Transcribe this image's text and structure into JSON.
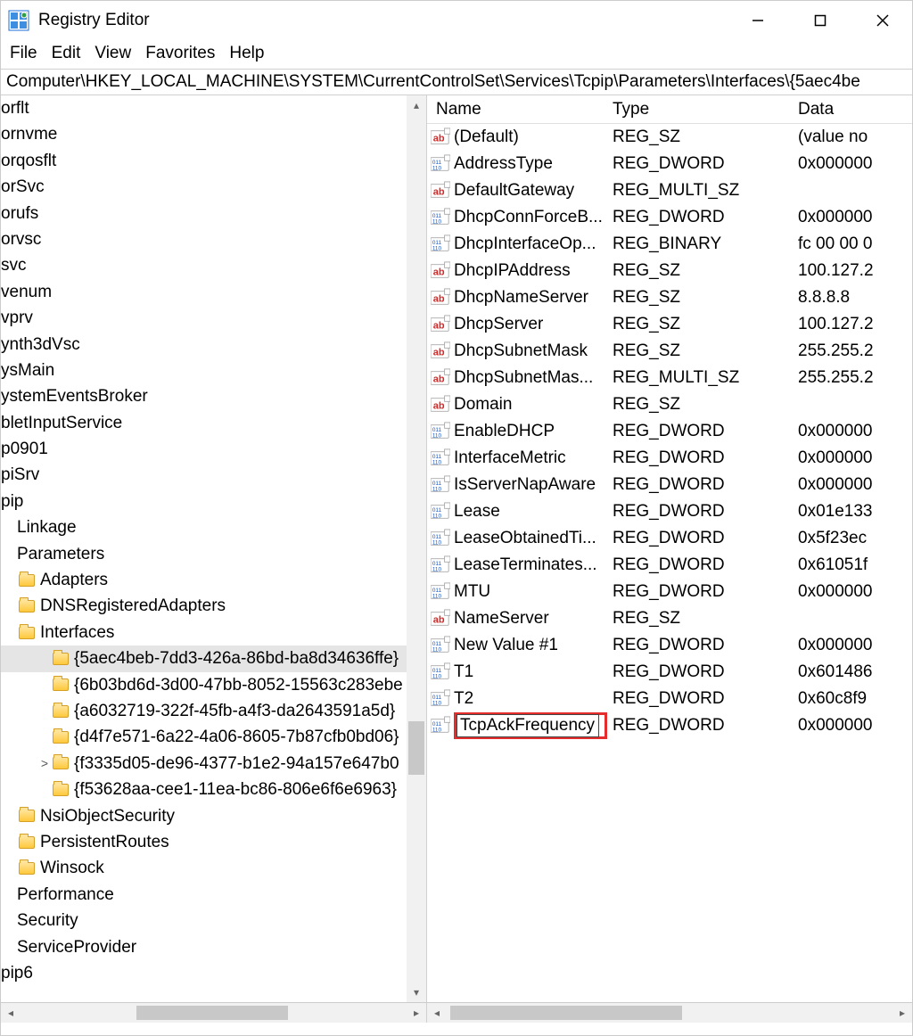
{
  "window": {
    "title": "Registry Editor"
  },
  "menu": {
    "file": "File",
    "edit": "Edit",
    "view": "View",
    "favorites": "Favorites",
    "help": "Help"
  },
  "address": "Computer\\HKEY_LOCAL_MACHINE\\SYSTEM\\CurrentControlSet\\Services\\Tcpip\\Parameters\\Interfaces\\{5aec4be",
  "tree": {
    "items": [
      {
        "label": "orflt",
        "indent": 1,
        "folder": false
      },
      {
        "label": "ornvme",
        "indent": 1,
        "folder": false
      },
      {
        "label": "orqosflt",
        "indent": 1,
        "folder": false
      },
      {
        "label": "orSvc",
        "indent": 1,
        "folder": false
      },
      {
        "label": "orufs",
        "indent": 1,
        "folder": false
      },
      {
        "label": "orvsc",
        "indent": 1,
        "folder": false
      },
      {
        "label": "svc",
        "indent": 1,
        "folder": false
      },
      {
        "label": "venum",
        "indent": 1,
        "folder": false
      },
      {
        "label": "vprv",
        "indent": 1,
        "folder": false
      },
      {
        "label": "ynth3dVsc",
        "indent": 1,
        "folder": false
      },
      {
        "label": "ysMain",
        "indent": 1,
        "folder": false
      },
      {
        "label": "ystemEventsBroker",
        "indent": 1,
        "folder": false
      },
      {
        "label": "bletInputService",
        "indent": 1,
        "folder": false
      },
      {
        "label": "p0901",
        "indent": 1,
        "folder": false
      },
      {
        "label": "piSrv",
        "indent": 1,
        "folder": false
      },
      {
        "label": "pip",
        "indent": 1,
        "folder": false
      },
      {
        "label": "Linkage",
        "indent": 2,
        "folder": false
      },
      {
        "label": "Parameters",
        "indent": 2,
        "folder": false
      },
      {
        "label": "Adapters",
        "indent": 3,
        "folder": true
      },
      {
        "label": "DNSRegisteredAdapters",
        "indent": 3,
        "folder": true
      },
      {
        "label": "Interfaces",
        "indent": 3,
        "folder": true
      },
      {
        "label": "{5aec4beb-7dd3-426a-86bd-ba8d34636ffe}",
        "indent": 4,
        "folder": true,
        "selected": true
      },
      {
        "label": "{6b03bd6d-3d00-47bb-8052-15563c283ebe",
        "indent": 4,
        "folder": true
      },
      {
        "label": "{a6032719-322f-45fb-a4f3-da2643591a5d}",
        "indent": 4,
        "folder": true
      },
      {
        "label": "{d4f7e571-6a22-4a06-8605-7b87cfb0bd06}",
        "indent": 4,
        "folder": true
      },
      {
        "label": "{f3335d05-de96-4377-b1e2-94a157e647b0",
        "indent": 4,
        "folder": true,
        "chev": ">"
      },
      {
        "label": "{f53628aa-cee1-11ea-bc86-806e6f6e6963}",
        "indent": 4,
        "folder": true
      },
      {
        "label": "NsiObjectSecurity",
        "indent": 3,
        "folder": true
      },
      {
        "label": "PersistentRoutes",
        "indent": 3,
        "folder": true
      },
      {
        "label": "Winsock",
        "indent": 3,
        "folder": true
      },
      {
        "label": "Performance",
        "indent": 2,
        "folder": false
      },
      {
        "label": "Security",
        "indent": 2,
        "folder": false
      },
      {
        "label": "ServiceProvider",
        "indent": 2,
        "folder": false
      },
      {
        "label": "pip6",
        "indent": 1,
        "folder": false
      }
    ]
  },
  "list": {
    "headers": {
      "name": "Name",
      "type": "Type",
      "data": "Data"
    },
    "rows": [
      {
        "icon": "ab",
        "name": "(Default)",
        "type": "REG_SZ",
        "data": "(value no"
      },
      {
        "icon": "110",
        "name": "AddressType",
        "type": "REG_DWORD",
        "data": "0x000000"
      },
      {
        "icon": "ab",
        "name": "DefaultGateway",
        "type": "REG_MULTI_SZ",
        "data": ""
      },
      {
        "icon": "110",
        "name": "DhcpConnForceB...",
        "type": "REG_DWORD",
        "data": "0x000000"
      },
      {
        "icon": "110",
        "name": "DhcpInterfaceOp...",
        "type": "REG_BINARY",
        "data": "fc 00 00 0"
      },
      {
        "icon": "ab",
        "name": "DhcpIPAddress",
        "type": "REG_SZ",
        "data": "100.127.2"
      },
      {
        "icon": "ab",
        "name": "DhcpNameServer",
        "type": "REG_SZ",
        "data": "8.8.8.8"
      },
      {
        "icon": "ab",
        "name": "DhcpServer",
        "type": "REG_SZ",
        "data": "100.127.2"
      },
      {
        "icon": "ab",
        "name": "DhcpSubnetMask",
        "type": "REG_SZ",
        "data": "255.255.2"
      },
      {
        "icon": "ab",
        "name": "DhcpSubnetMas...",
        "type": "REG_MULTI_SZ",
        "data": "255.255.2"
      },
      {
        "icon": "ab",
        "name": "Domain",
        "type": "REG_SZ",
        "data": ""
      },
      {
        "icon": "110",
        "name": "EnableDHCP",
        "type": "REG_DWORD",
        "data": "0x000000"
      },
      {
        "icon": "110",
        "name": "InterfaceMetric",
        "type": "REG_DWORD",
        "data": "0x000000"
      },
      {
        "icon": "110",
        "name": "IsServerNapAware",
        "type": "REG_DWORD",
        "data": "0x000000"
      },
      {
        "icon": "110",
        "name": "Lease",
        "type": "REG_DWORD",
        "data": "0x01e133"
      },
      {
        "icon": "110",
        "name": "LeaseObtainedTi...",
        "type": "REG_DWORD",
        "data": "0x5f23ec"
      },
      {
        "icon": "110",
        "name": "LeaseTerminates...",
        "type": "REG_DWORD",
        "data": "0x61051f"
      },
      {
        "icon": "110",
        "name": "MTU",
        "type": "REG_DWORD",
        "data": "0x000000"
      },
      {
        "icon": "ab",
        "name": "NameServer",
        "type": "REG_SZ",
        "data": ""
      },
      {
        "icon": "110",
        "name": "New Value #1",
        "type": "REG_DWORD",
        "data": "0x000000"
      },
      {
        "icon": "110",
        "name": "T1",
        "type": "REG_DWORD",
        "data": "0x601486"
      },
      {
        "icon": "110",
        "name": "T2",
        "type": "REG_DWORD",
        "data": "0x60c8f9"
      },
      {
        "icon": "110",
        "name": "TcpAckFrequency",
        "type": "REG_DWORD",
        "data": "0x000000",
        "editing": true
      }
    ]
  }
}
